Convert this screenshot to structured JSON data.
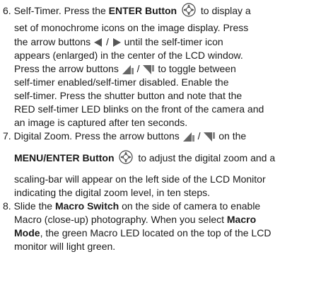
{
  "items": [
    {
      "num": "6.",
      "lines": [
        [
          "Self-Timer.   Press the ",
          "ENTER Button",
          " to display a"
        ],
        [
          "set of monochrome icons on the image display.   Press"
        ],
        [
          "the arrow buttons ",
          " / ",
          " until the self-timer icon"
        ],
        [
          "appears (enlarged) in the center of the LCD window."
        ],
        [
          "Press the arrow buttons ",
          " / ",
          " to toggle between"
        ],
        [
          "self-timer enabled/self-timer disabled.   Enable the"
        ],
        [
          "self-timer.   Press the shutter button and note that the"
        ],
        [
          "RED self-timer LED blinks on the front of the camera and"
        ],
        [
          "an image is captured after ten seconds."
        ]
      ]
    },
    {
      "num": "7.",
      "lines": [
        [
          "Digital Zoom.   Press the arrow buttons ",
          " / ",
          " on the"
        ],
        [
          "MENU/ENTER Button",
          " to adjust the digital zoom and a"
        ],
        [
          "scaling-bar will appear on the left side of the LCD Monitor"
        ],
        [
          "indicating the digital zoom level, in ten steps."
        ]
      ]
    },
    {
      "num": "8.",
      "lines": [
        [
          "Slide the ",
          "Macro Switch",
          " on the side of camera to enable"
        ],
        [
          "Macro (close-up) photography. When you select ",
          "Macro"
        ],
        [
          "Mode",
          ", the green Macro LED located on the top of the LCD"
        ],
        [
          "monitor will light green."
        ]
      ]
    }
  ],
  "icons": {
    "enter": "four-way-enter-button-icon",
    "left": "left-arrow-icon",
    "right": "right-arrow-icon",
    "up": "up-arrow-icon",
    "down": "down-arrow-icon"
  }
}
